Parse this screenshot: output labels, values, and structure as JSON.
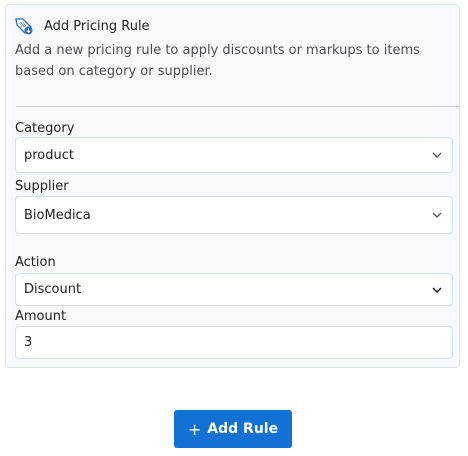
{
  "header": {
    "title": "Add Pricing Rule",
    "icon": "percent-tag-icon"
  },
  "description": "Add a new pricing rule to apply discounts or markups to items based on category or supplier.",
  "form": {
    "category": {
      "label": "Category",
      "value": "product"
    },
    "supplier": {
      "label": "Supplier",
      "value": "BioMedica"
    },
    "action": {
      "label": "Action",
      "value": "Discount"
    },
    "amount": {
      "label": "Amount",
      "value": "3"
    }
  },
  "submit": {
    "label": "Add Rule",
    "icon": "plus-icon",
    "color": "#1172d4"
  }
}
